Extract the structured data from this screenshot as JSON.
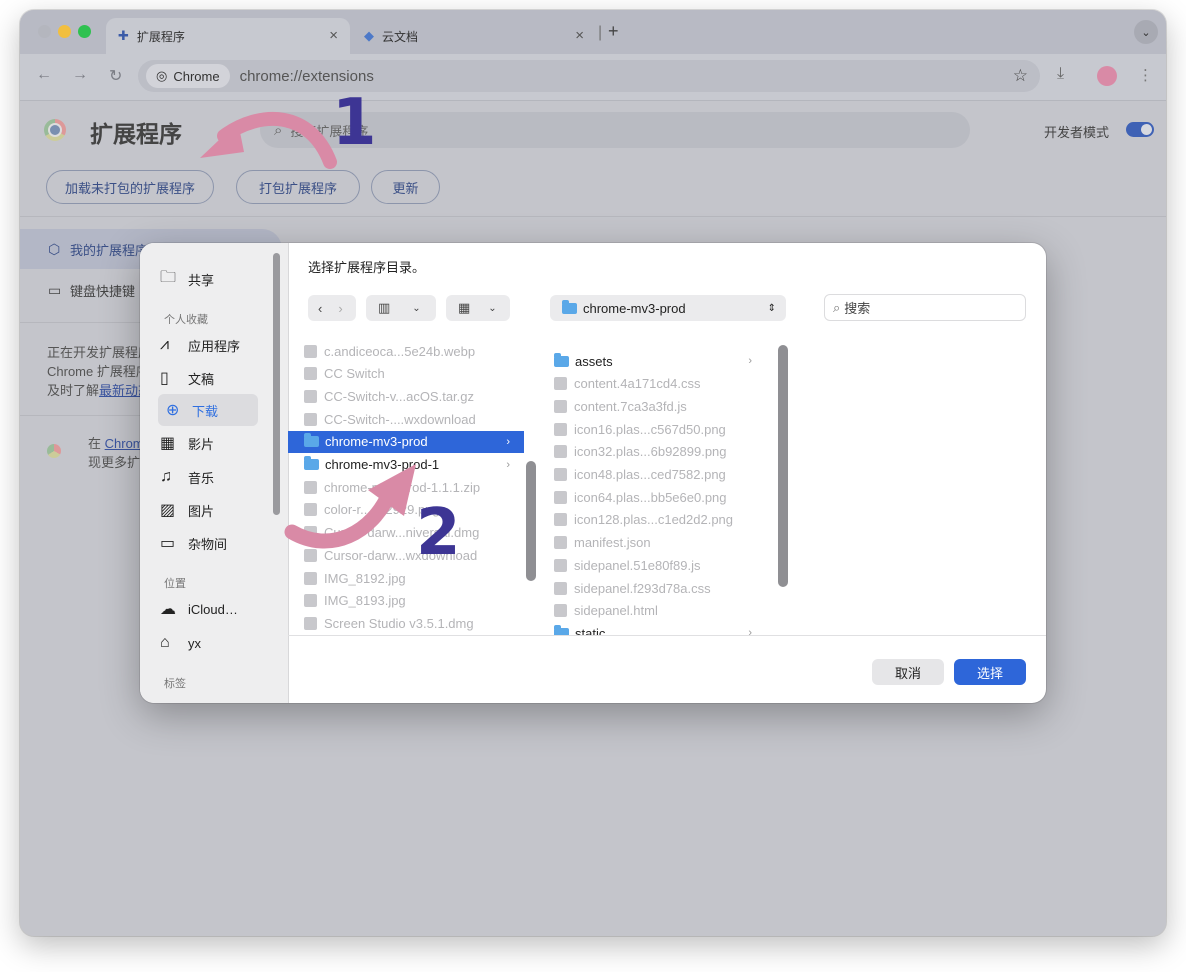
{
  "browser": {
    "tabs": [
      {
        "icon": "puzzle-icon",
        "title": "扩展程序",
        "active": true
      },
      {
        "icon": "cloud-doc-icon",
        "title": "云文档",
        "active": false
      }
    ],
    "omnibox": {
      "chip": "Chrome",
      "url": "chrome://extensions"
    }
  },
  "page": {
    "title": "扩展程序",
    "search_placeholder": "搜索扩展程序",
    "dev_mode_label": "开发者模式",
    "dev_mode_on": true,
    "actions": [
      "加载未打包的扩展程序",
      "打包扩展程序",
      "更新"
    ],
    "sidebar": [
      {
        "label": "我的扩展程序",
        "selected": true
      },
      {
        "label": "键盘快捷键",
        "selected": false
      }
    ],
    "dev_text": {
      "line1": "正在开发扩展程序？请访问",
      "line2": "Chrome 扩展程序文档，",
      "line3": "及时了解",
      "link": "最新动态"
    },
    "store_text": {
      "prefix": "在 ",
      "link": "Chrome 应用商店",
      "line2": "现更多扩展程序和主题"
    }
  },
  "annotations": {
    "step1": "1",
    "step2": "2"
  },
  "dialog": {
    "title": "选择扩展程序目录。",
    "path": "chrome-mv3-prod",
    "search_placeholder": "搜索",
    "sidebar": {
      "share": "共享",
      "favorites_header": "个人收藏",
      "favorites": [
        "应用程序",
        "文稿",
        "下载",
        "影片",
        "音乐",
        "图片",
        "杂物间"
      ],
      "locations_header": "位置",
      "locations": [
        "iCloud…",
        "yx"
      ],
      "tags_header": "标签"
    },
    "column1": [
      {
        "name": "c.andiceoca...5e24b.webp",
        "enabled": false
      },
      {
        "name": "CC Switch",
        "enabled": false
      },
      {
        "name": "CC-Switch-v...acOS.tar.gz",
        "enabled": false
      },
      {
        "name": "CC-Switch-....wxdownload",
        "enabled": false
      },
      {
        "name": "chrome-mv3-prod",
        "enabled": true,
        "selected": true,
        "folder": true
      },
      {
        "name": "chrome-mv3-prod-1",
        "enabled": true,
        "folder": true
      },
      {
        "name": "chrome-mv3-prod-1.1.1.zip",
        "enabled": false
      },
      {
        "name": "color-r...4b2929.png",
        "enabled": false
      },
      {
        "name": "Cursor-darw...niversal.dmg",
        "enabled": false
      },
      {
        "name": "Cursor-darw...wxdownload",
        "enabled": false
      },
      {
        "name": "IMG_8192.jpg",
        "enabled": false
      },
      {
        "name": "IMG_8193.jpg",
        "enabled": false
      },
      {
        "name": "Screen Studio v3.5.1.dmg",
        "enabled": false
      }
    ],
    "column2": [
      {
        "name": "assets",
        "enabled": true,
        "folder": true
      },
      {
        "name": "content.4a171cd4.css",
        "enabled": false
      },
      {
        "name": "content.7ca3a3fd.js",
        "enabled": false
      },
      {
        "name": "icon16.plas...c567d50.png",
        "enabled": false
      },
      {
        "name": "icon32.plas...6b92899.png",
        "enabled": false
      },
      {
        "name": "icon48.plas...ced7582.png",
        "enabled": false
      },
      {
        "name": "icon64.plas...bb5e6e0.png",
        "enabled": false
      },
      {
        "name": "icon128.plas...c1ed2d2.png",
        "enabled": false
      },
      {
        "name": "manifest.json",
        "enabled": false
      },
      {
        "name": "sidepanel.51e80f89.js",
        "enabled": false
      },
      {
        "name": "sidepanel.f293d78a.css",
        "enabled": false
      },
      {
        "name": "sidepanel.html",
        "enabled": false
      },
      {
        "name": "static",
        "enabled": true,
        "folder": true
      }
    ],
    "cancel_label": "取消",
    "choose_label": "选择"
  },
  "colors": {
    "accent": "#2e66d9",
    "annotation_arrow": "#d98aa6",
    "annotation_number": "#3d3594"
  }
}
